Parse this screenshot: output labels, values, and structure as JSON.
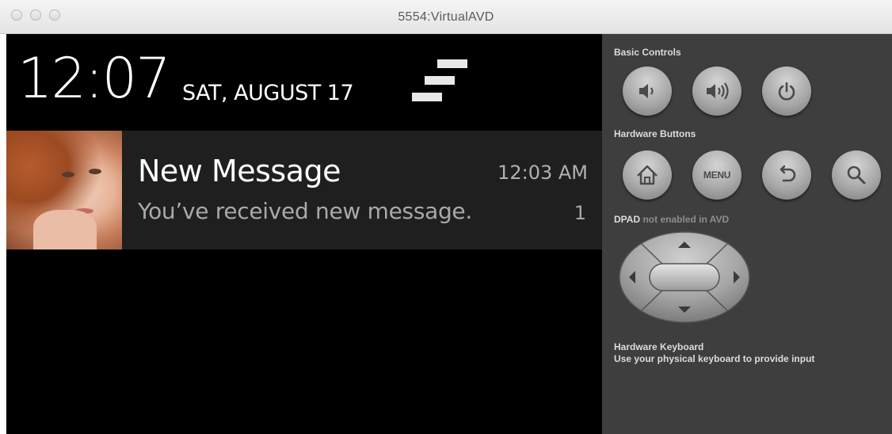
{
  "window": {
    "title": "5554:VirtualAVD"
  },
  "status_bar": {
    "time": "12:07",
    "date": "SAT, AUGUST 17",
    "settings_icon": "quick-settings-icon"
  },
  "notification": {
    "title": "New Message",
    "time": "12:03 AM",
    "body": "You’ve received new message.",
    "count": "1",
    "avatar": "contact-photo"
  },
  "controls": {
    "basic_label": "Basic Controls",
    "basic_buttons": [
      {
        "name": "volume-down",
        "icon": "volume-down-icon"
      },
      {
        "name": "volume-up",
        "icon": "volume-up-icon"
      },
      {
        "name": "power",
        "icon": "power-icon"
      }
    ],
    "hardware_label": "Hardware Buttons",
    "hardware_buttons": [
      {
        "name": "home",
        "icon": "home-icon"
      },
      {
        "name": "menu",
        "label": "MENU"
      },
      {
        "name": "back",
        "icon": "back-icon"
      },
      {
        "name": "search",
        "icon": "search-icon"
      }
    ],
    "dpad_label_strong": "DPAD",
    "dpad_label_rest": " not enabled in AVD",
    "keyboard_title": "Hardware Keyboard",
    "keyboard_desc": "Use your physical keyboard to provide input"
  }
}
